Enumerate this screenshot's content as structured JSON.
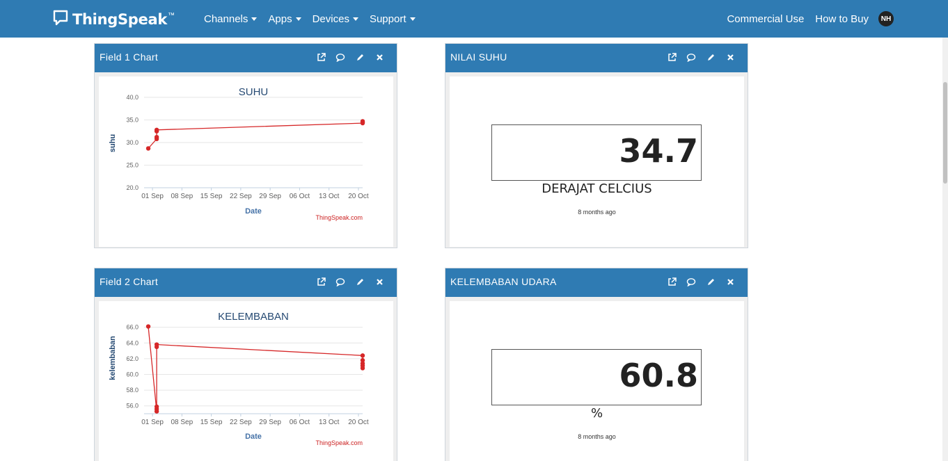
{
  "navbar": {
    "brand": "ThingSpeak",
    "brand_tm": "™",
    "menu": [
      {
        "label": "Channels"
      },
      {
        "label": "Apps"
      },
      {
        "label": "Devices"
      },
      {
        "label": "Support"
      }
    ],
    "right": {
      "commercial": "Commercial Use",
      "how_to_buy": "How to Buy",
      "avatar_initials": "NH"
    }
  },
  "widgets": {
    "field1": {
      "title": "Field 1 Chart",
      "chart_title": "SUHU",
      "y_label": "suhu",
      "x_label": "Date",
      "credit": "ThingSpeak.com"
    },
    "nilai_suhu": {
      "title": "NILAI SUHU",
      "value": "34.7",
      "unit": "DERAJAT CELCIUS",
      "updated": "8 months ago"
    },
    "field2": {
      "title": "Field 2 Chart",
      "chart_title": "KELEMBABAN",
      "y_label": "kelembaban",
      "x_label": "Date",
      "credit": "ThingSpeak.com"
    },
    "kelembaban": {
      "title": "KELEMBABAN UDARA",
      "value": "60.8",
      "unit": "%",
      "updated": "8 months ago"
    }
  },
  "icons": [
    "external-link-icon",
    "comment-icon",
    "pencil-icon",
    "close-icon"
  ],
  "colors": {
    "accent": "#2f7bb3",
    "series": "#d62728"
  },
  "chart_data": [
    {
      "type": "line",
      "title": "SUHU",
      "xlabel": "Date",
      "ylabel": "suhu",
      "ylim": [
        20,
        40
      ],
      "yticks": [
        "20.0",
        "25.0",
        "30.0",
        "35.0",
        "40.0"
      ],
      "xticks": [
        "01 Sep",
        "08 Sep",
        "15 Sep",
        "22 Sep",
        "29 Sep",
        "06 Oct",
        "13 Oct",
        "20 Oct"
      ],
      "grid": true,
      "points": [
        {
          "x": "2023-08-31",
          "y": 28.7
        },
        {
          "x": "2023-09-02",
          "y": 30.8
        },
        {
          "x": "2023-09-02",
          "y": 31.2
        },
        {
          "x": "2023-09-02",
          "y": 32.5
        },
        {
          "x": "2023-09-02",
          "y": 32.8
        },
        {
          "x": "2023-10-21",
          "y": 34.3
        },
        {
          "x": "2023-10-21",
          "y": 34.5
        },
        {
          "x": "2023-10-21",
          "y": 34.7
        }
      ]
    },
    {
      "type": "line",
      "title": "KELEMBABAN",
      "xlabel": "Date",
      "ylabel": "kelembaban",
      "ylim": [
        55,
        66.5
      ],
      "yticks": [
        "56.0",
        "58.0",
        "60.0",
        "62.0",
        "64.0",
        "66.0"
      ],
      "xticks": [
        "01 Sep",
        "08 Sep",
        "15 Sep",
        "22 Sep",
        "29 Sep",
        "06 Oct",
        "13 Oct",
        "20 Oct"
      ],
      "grid": true,
      "points": [
        {
          "x": "2023-08-31",
          "y": 66.1
        },
        {
          "x": "2023-09-02",
          "y": 55.3
        },
        {
          "x": "2023-09-02",
          "y": 55.6
        },
        {
          "x": "2023-09-02",
          "y": 55.9
        },
        {
          "x": "2023-09-02",
          "y": 63.5
        },
        {
          "x": "2023-09-02",
          "y": 63.8
        },
        {
          "x": "2023-10-21",
          "y": 62.4
        },
        {
          "x": "2023-10-21",
          "y": 61.8
        },
        {
          "x": "2023-10-21",
          "y": 61.4
        },
        {
          "x": "2023-10-21",
          "y": 61.1
        },
        {
          "x": "2023-10-21",
          "y": 60.8
        }
      ]
    }
  ]
}
